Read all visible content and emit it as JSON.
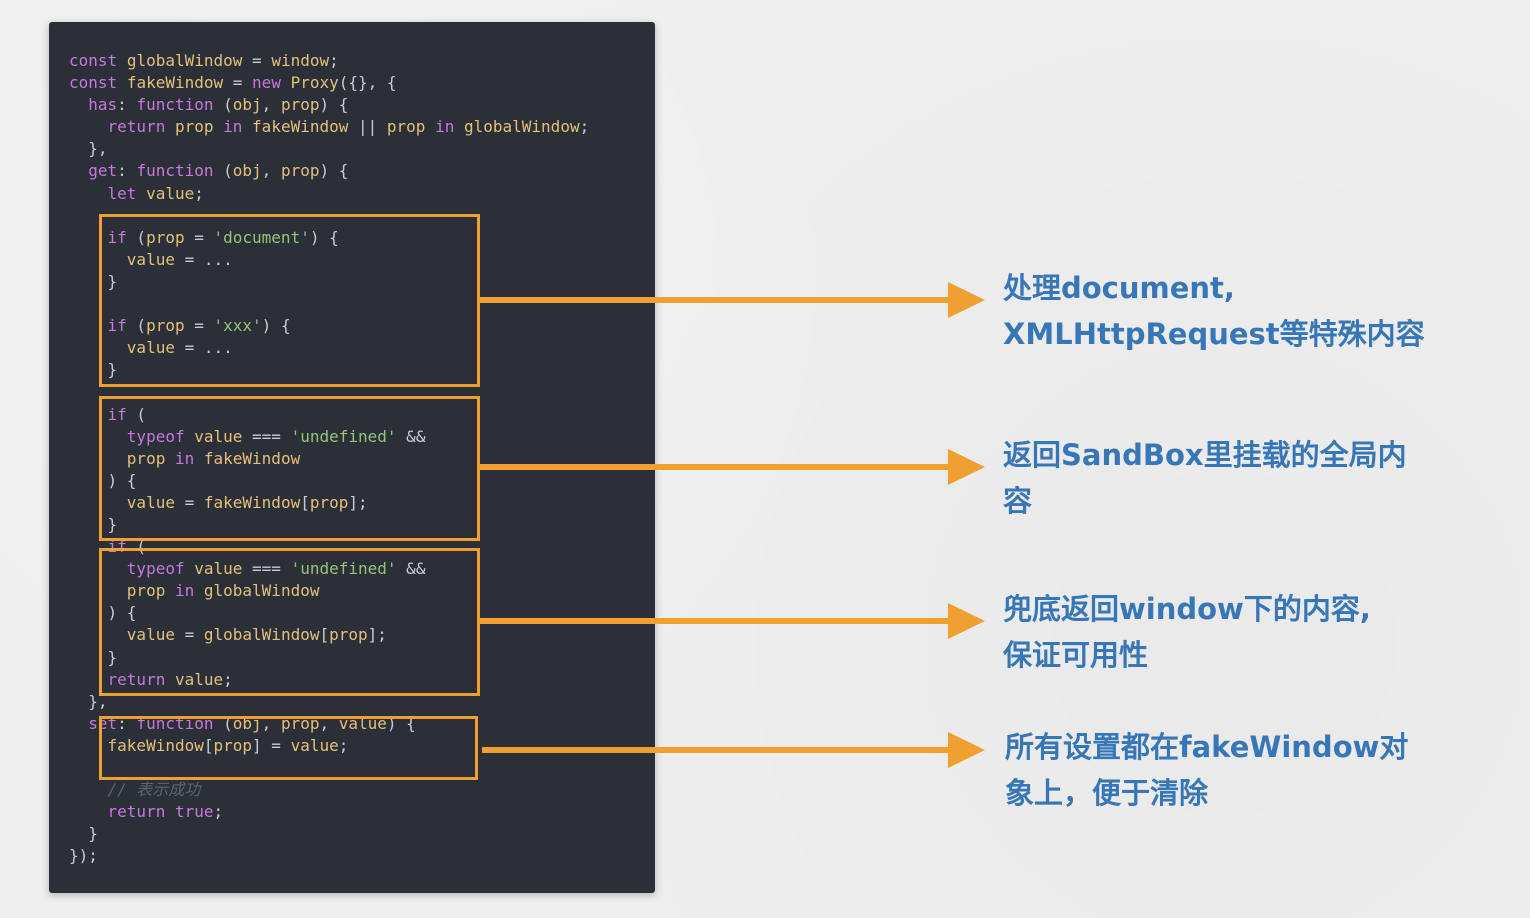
{
  "code_lines": [
    "const globalWindow = window;",
    "const fakeWindow = new Proxy({}, {",
    "  has: function (obj, prop) {",
    "    return prop in fakeWindow || prop in globalWindow;",
    "  },",
    "  get: function (obj, prop) {",
    "    let value;",
    "",
    "    if (prop = 'document') {",
    "      value = ...",
    "    }",
    "",
    "    if (prop = 'xxx') {",
    "      value = ...",
    "    }",
    "",
    "    if (",
    "      typeof value === 'undefined' &&",
    "      prop in fakeWindow",
    "    ) {",
    "      value = fakeWindow[prop];",
    "    }",
    "    if (",
    "      typeof value === 'undefined' &&",
    "      prop in globalWindow",
    "    ) {",
    "      value = globalWindow[prop];",
    "    }",
    "    return value;",
    "  },",
    "  set: function (obj, prop, value) {",
    "    fakeWindow[prop] = value;",
    "",
    "    // 表示成功",
    "    return true;",
    "  }",
    "});"
  ],
  "annotations": [
    {
      "text": "处理document,\nXMLHttpRequest等特殊内容"
    },
    {
      "text": "返回SandBox里挂载的全局内\n容"
    },
    {
      "text": "兜底返回window下的内容,\n保证可用性"
    },
    {
      "text": "所有设置都在fakeWindow对\n象上，便于清除"
    }
  ],
  "colors": {
    "panel": "#2b2f37",
    "highlight": "#f0a030",
    "annotation_text": "#3777b8",
    "keyword": "#c678dd",
    "identifier": "#e5c07b",
    "string": "#98c379"
  }
}
